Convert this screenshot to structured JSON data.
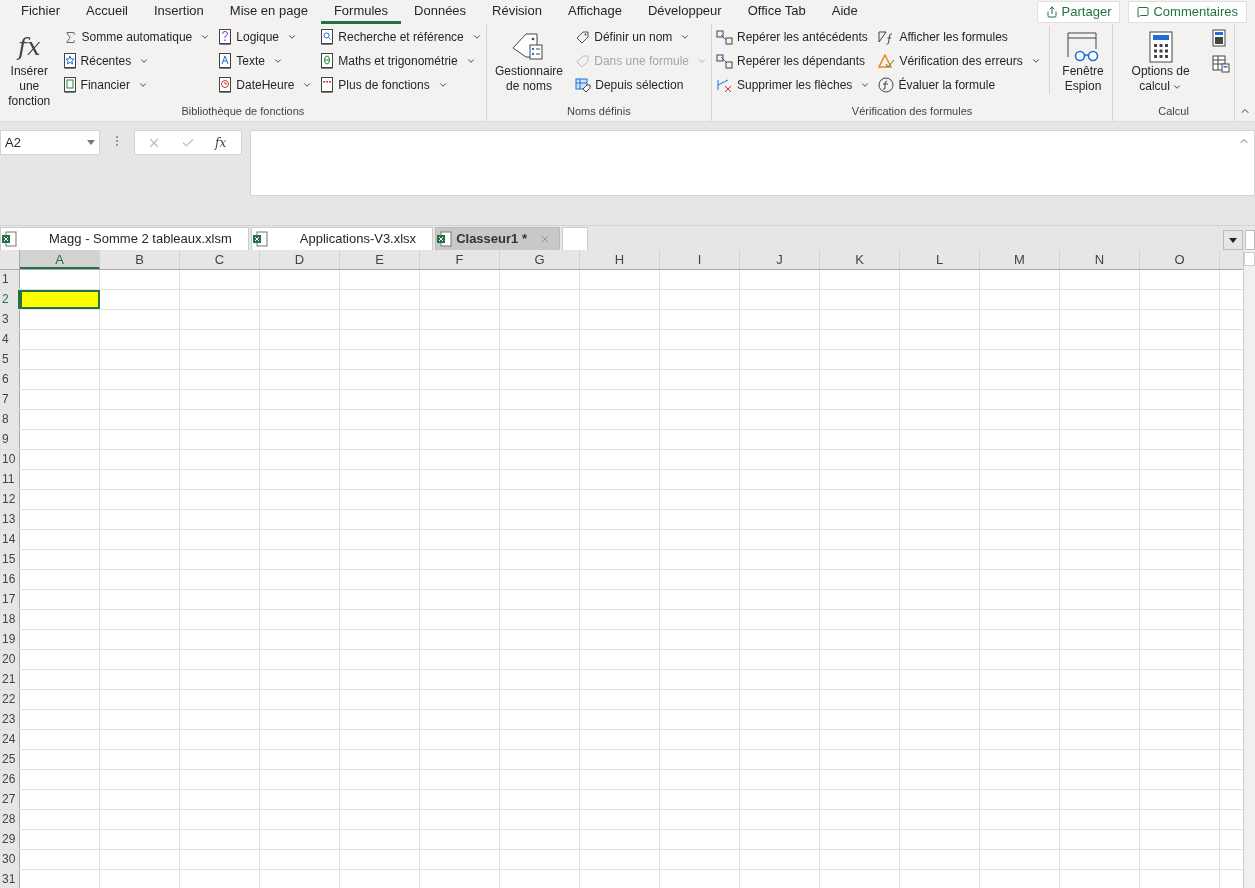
{
  "menu_tabs": [
    {
      "label": "Fichier",
      "selected": false
    },
    {
      "label": "Accueil",
      "selected": false
    },
    {
      "label": "Insertion",
      "selected": false
    },
    {
      "label": "Mise en page",
      "selected": false
    },
    {
      "label": "Formules",
      "selected": true
    },
    {
      "label": "Données",
      "selected": false
    },
    {
      "label": "Révision",
      "selected": false
    },
    {
      "label": "Affichage",
      "selected": false
    },
    {
      "label": "Développeur",
      "selected": false
    },
    {
      "label": "Office Tab",
      "selected": false
    },
    {
      "label": "Aide",
      "selected": false
    }
  ],
  "share_buttons": [
    "Partager",
    "Commentaires"
  ],
  "ribbon_groups": [
    {
      "label": "Bibliothèque de fonctions",
      "columns": [
        [
          {
            "kind": "large",
            "glyph": "fx",
            "label": "Insérer une fonction",
            "dropdown": false,
            "disabled": false
          }
        ],
        [
          {
            "kind": "small",
            "label": "Somme automatique",
            "dropdown": true,
            "disabled": false
          },
          {
            "kind": "small",
            "label": "Récentes",
            "dropdown": true,
            "disabled": false
          },
          {
            "kind": "small",
            "label": "Financier",
            "dropdown": true,
            "disabled": false
          }
        ],
        [
          {
            "kind": "small",
            "label": "Logique",
            "dropdown": true,
            "disabled": false
          },
          {
            "kind": "small",
            "label": "Texte",
            "dropdown": true,
            "disabled": false
          },
          {
            "kind": "small",
            "label": "DateHeure",
            "dropdown": true,
            "disabled": false
          }
        ],
        [
          {
            "kind": "small",
            "label": "Recherche et référence",
            "dropdown": true,
            "disabled": false
          },
          {
            "kind": "small",
            "label": "Maths et trigonométrie",
            "dropdown": true,
            "disabled": false
          },
          {
            "kind": "small",
            "label": "Plus de fonctions",
            "dropdown": true,
            "disabled": false
          }
        ]
      ]
    },
    {
      "label": "Noms définis",
      "columns": [
        [
          {
            "kind": "large",
            "label": "Gestionnaire de noms",
            "dropdown": false,
            "disabled": false
          }
        ],
        [
          {
            "kind": "small",
            "label": "Définir un nom",
            "dropdown": true,
            "disabled": false
          },
          {
            "kind": "small",
            "label": "Dans une formule",
            "dropdown": true,
            "disabled": true
          },
          {
            "kind": "small",
            "label": "Depuis sélection",
            "dropdown": false,
            "disabled": false
          }
        ]
      ]
    },
    {
      "label": "Vérification des formules",
      "columns": [
        [
          {
            "kind": "small",
            "label": "Repérer les antécédents",
            "dropdown": false,
            "disabled": false
          },
          {
            "kind": "small",
            "label": "Repérer les dépendants",
            "dropdown": false,
            "disabled": false
          },
          {
            "kind": "small",
            "label": "Supprimer les flèches",
            "dropdown": true,
            "disabled": false
          }
        ],
        [
          {
            "kind": "small",
            "label": "Afficher les formules",
            "dropdown": false,
            "disabled": false
          },
          {
            "kind": "small",
            "label": "Vérification des erreurs",
            "dropdown": true,
            "disabled": false
          },
          {
            "kind": "small",
            "label": "Évaluer la formule",
            "dropdown": false,
            "disabled": false
          }
        ],
        [
          {
            "kind": "large",
            "label": "Fenêtre Espion",
            "dropdown": false,
            "disabled": false
          }
        ]
      ]
    },
    {
      "label": "Calcul",
      "columns": [
        [
          {
            "kind": "large",
            "label": "Options de calcul",
            "dropdown": true,
            "disabled": false
          }
        ],
        [
          {
            "kind": "icon"
          },
          {
            "kind": "icon"
          }
        ]
      ]
    }
  ],
  "formula_bar": {
    "name_box": "A2",
    "fx": "fx"
  },
  "workbook_tabs": [
    {
      "label": "Magg - Somme 2 tableaux.xlsm",
      "selected": false
    },
    {
      "label": "Applications-V3.xlsx",
      "selected": false
    },
    {
      "label": "Classeur1 *",
      "selected": true
    }
  ],
  "columns": [
    {
      "label": "A",
      "selected": true
    },
    {
      "label": "B",
      "selected": false
    },
    {
      "label": "C",
      "selected": false
    },
    {
      "label": "D",
      "selected": false
    },
    {
      "label": "E",
      "selected": false
    },
    {
      "label": "F",
      "selected": false
    },
    {
      "label": "G",
      "selected": false
    },
    {
      "label": "H",
      "selected": false
    },
    {
      "label": "I",
      "selected": false
    },
    {
      "label": "J",
      "selected": false
    },
    {
      "label": "K",
      "selected": false
    },
    {
      "label": "L",
      "selected": false
    },
    {
      "label": "M",
      "selected": false
    },
    {
      "label": "N",
      "selected": false
    },
    {
      "label": "O",
      "selected": false
    }
  ],
  "rows": [
    {
      "label": "1",
      "selected": false
    },
    {
      "label": "2",
      "selected": true
    },
    {
      "label": "3",
      "selected": false
    },
    {
      "label": "4",
      "selected": false
    },
    {
      "label": "5",
      "selected": false
    },
    {
      "label": "6",
      "selected": false
    },
    {
      "label": "7",
      "selected": false
    },
    {
      "label": "8",
      "selected": false
    },
    {
      "label": "9",
      "selected": false
    },
    {
      "label": "10",
      "selected": false
    },
    {
      "label": "11",
      "selected": false
    },
    {
      "label": "12",
      "selected": false
    },
    {
      "label": "13",
      "selected": false
    },
    {
      "label": "14",
      "selected": false
    },
    {
      "label": "15",
      "selected": false
    },
    {
      "label": "16",
      "selected": false
    },
    {
      "label": "17",
      "selected": false
    },
    {
      "label": "18",
      "selected": false
    },
    {
      "label": "19",
      "selected": false
    },
    {
      "label": "20",
      "selected": false
    },
    {
      "label": "21",
      "selected": false
    },
    {
      "label": "22",
      "selected": false
    },
    {
      "label": "23",
      "selected": false
    },
    {
      "label": "24",
      "selected": false
    },
    {
      "label": "25",
      "selected": false
    },
    {
      "label": "26",
      "selected": false
    },
    {
      "label": "27",
      "selected": false
    },
    {
      "label": "28",
      "selected": false
    },
    {
      "label": "29",
      "selected": false
    },
    {
      "label": "30",
      "selected": false
    },
    {
      "label": "31",
      "selected": false
    }
  ],
  "active_cell": {
    "color": "#ffff00"
  }
}
